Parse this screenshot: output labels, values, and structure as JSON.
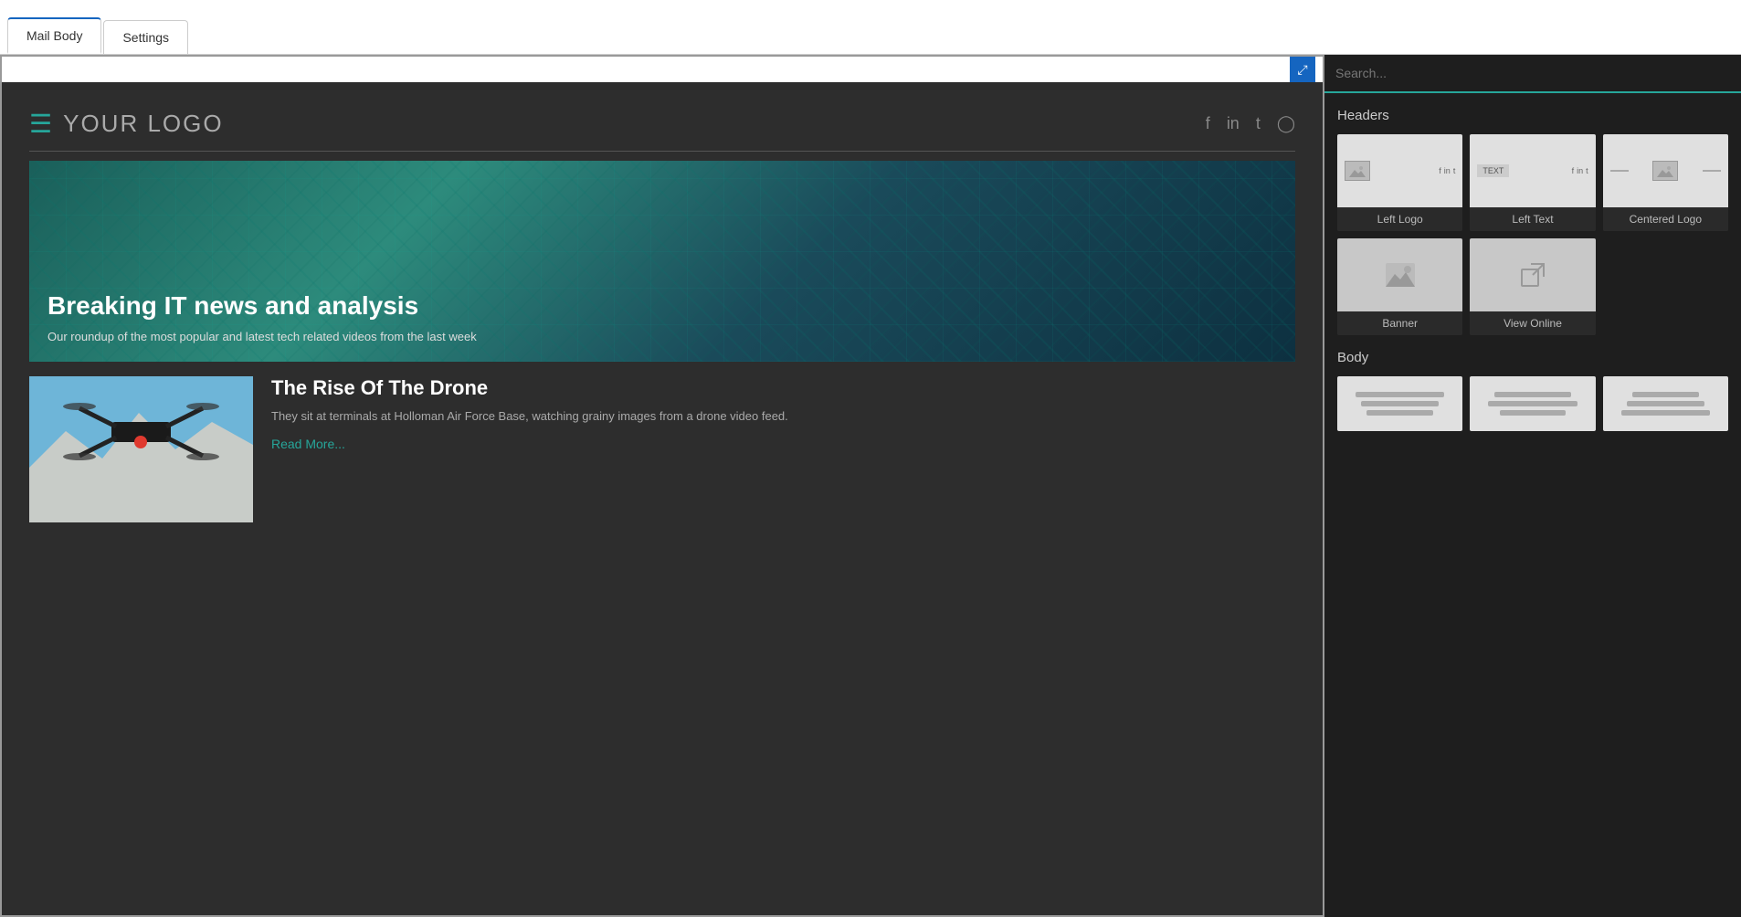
{
  "tabs": {
    "mail_body": "Mail Body",
    "settings": "Settings"
  },
  "expand_icon": "⤢",
  "email": {
    "logo_text": "YOUR LOGO",
    "banner_title": "Breaking IT news and analysis",
    "banner_subtitle": "Our roundup of the most popular and latest tech related videos from the last week",
    "article": {
      "title": "The Rise Of The Drone",
      "description": "They sit at terminals at Holloman Air Force Base, watching grainy images from a drone video feed.",
      "read_more": "Read More..."
    }
  },
  "panel": {
    "search_placeholder": "Search...",
    "headers_label": "Headers",
    "body_label": "Body",
    "items": [
      {
        "label": "Left Logo"
      },
      {
        "label": "Left Text"
      },
      {
        "label": "Centered Logo"
      },
      {
        "label": "Banner"
      },
      {
        "label": "View Online"
      }
    ]
  }
}
